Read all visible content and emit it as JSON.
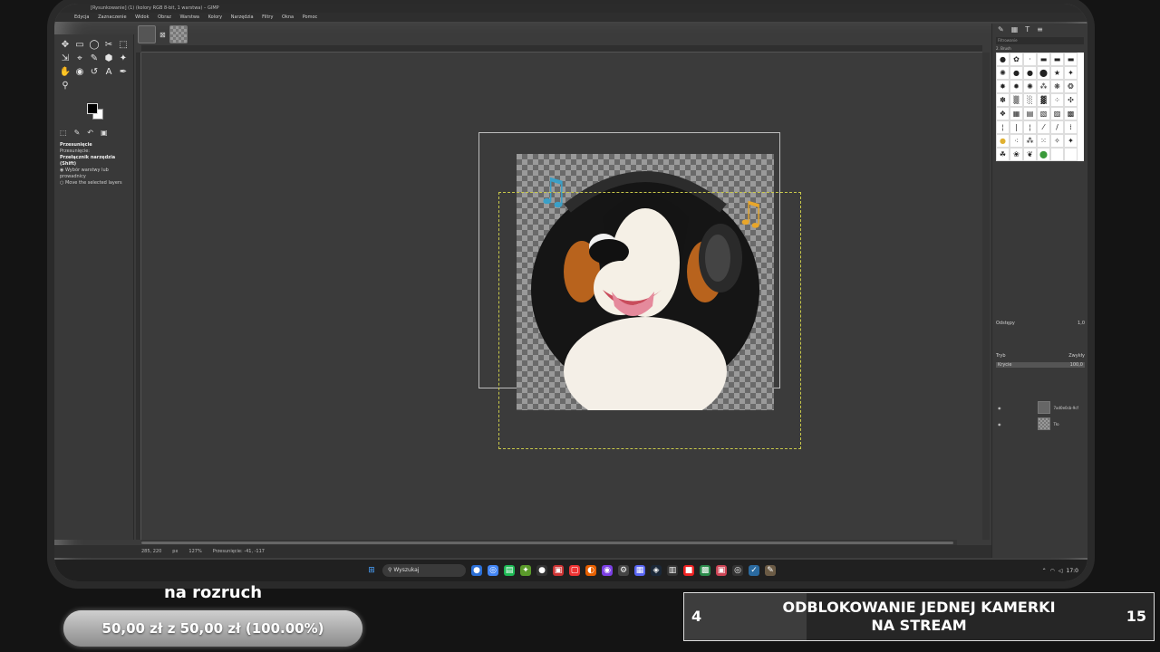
{
  "window": {
    "title": "[Rysunkowanie] (1) (kolory RGB 8-bit, 1 warstwa) – GIMP"
  },
  "menubar": [
    "Edycja",
    "Zaznaczenie",
    "Widok",
    "Obraz",
    "Warstwa",
    "Kolory",
    "Narzędzia",
    "Filtry",
    "Okna",
    "Pomoc"
  ],
  "toolbox": {
    "tools": [
      "✥",
      "▭",
      "◯",
      "✂",
      "⬚",
      "⇲",
      "⌖",
      "✎",
      "⬢",
      "✦",
      "✋",
      "◉",
      "↺",
      "A",
      "✒",
      "⚲"
    ],
    "options_title": "Przesunięcie",
    "options_mode_label": "Przesunięcie:",
    "options_switch_title": "Przełącznik narzędzia (Shift)",
    "option_1": "Wybór warstwy lub prowadnicy",
    "option_2": "Move the selected layers"
  },
  "statusbar": {
    "coords": "285, 220",
    "unit": "px",
    "zoom": "127%",
    "message": "Przesunięcie: -41, -117"
  },
  "right_panel": {
    "filter_placeholder": "Filtrowanie",
    "brush_label": "2. Brush",
    "spacing_label": "Odstępy",
    "spacing_value": "1,0",
    "mode_label": "Tryb",
    "mode_value": "Zwykły",
    "opacity_label": "Krycie",
    "opacity_value": "100,0",
    "layers": [
      {
        "name": "7ad0e0cb-9cf"
      },
      {
        "name": "Tło"
      }
    ]
  },
  "taskbar": {
    "search_placeholder": "Wyszukaj",
    "time": "17:0"
  },
  "stream_overlay": {
    "warmup_label": "na rozruch",
    "progress_text": "50,00 zł z 50,00 zł (100.00%)",
    "progress_fraction": 1.0,
    "goal_current": "4",
    "goal_target": "15",
    "goal_fraction": 0.26,
    "goal_title": "ODBLOKOWANIE JEDNEJ KAMERKI\nNA STREAM"
  }
}
